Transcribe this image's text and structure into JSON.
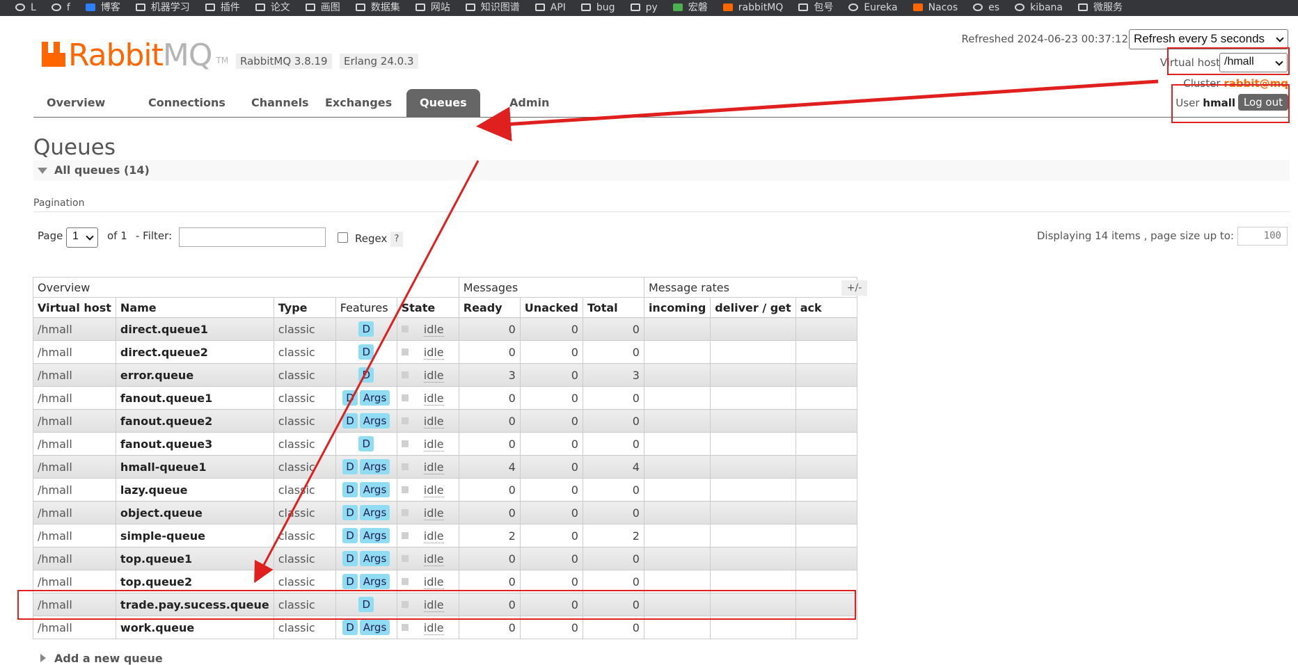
{
  "bookmarks": [
    {
      "label": "L",
      "icon": "github-icon"
    },
    {
      "label": "f",
      "icon": "github-icon"
    },
    {
      "label": "博客",
      "icon": "blog-icon"
    },
    {
      "label": "机器学习",
      "icon": "folder-icon"
    },
    {
      "label": "插件",
      "icon": "folder-icon"
    },
    {
      "label": "论文",
      "icon": "folder-icon"
    },
    {
      "label": "画图",
      "icon": "folder-icon"
    },
    {
      "label": "数据集",
      "icon": "folder-icon"
    },
    {
      "label": "网站",
      "icon": "folder-icon"
    },
    {
      "label": "知识图谱",
      "icon": "folder-icon"
    },
    {
      "label": "API",
      "icon": "folder-icon"
    },
    {
      "label": "bug",
      "icon": "folder-icon"
    },
    {
      "label": "py",
      "icon": "folder-icon"
    },
    {
      "label": "宏磐",
      "icon": "green-icon"
    },
    {
      "label": "rabbitMQ",
      "icon": "rabbitmq-icon"
    },
    {
      "label": "包号",
      "icon": "folder-icon"
    },
    {
      "label": "Eureka",
      "icon": "globe-icon"
    },
    {
      "label": "Nacos",
      "icon": "nacos-icon"
    },
    {
      "label": "es",
      "icon": "elastic-icon"
    },
    {
      "label": "kibana",
      "icon": "kibana-icon"
    },
    {
      "label": "微服务",
      "icon": "folder-icon"
    }
  ],
  "header": {
    "logo_rabbit": "Rabbit",
    "logo_mq": "MQ",
    "logo_tm": "TM",
    "version": "RabbitMQ 3.8.19",
    "erlang": "Erlang 24.0.3",
    "refreshed": "Refreshed 2024-06-23 00:37:12",
    "refresh_select": "Refresh every 5 seconds",
    "vhost_label": "Virtual host",
    "vhost_value": "/hmall",
    "cluster_label": "Cluster",
    "cluster_value": "rabbit@mq",
    "user_label": "User",
    "user_value": "hmall",
    "logout": "Log out"
  },
  "tabs": [
    "Overview",
    "Connections",
    "Channels",
    "Exchanges",
    "Queues",
    "Admin"
  ],
  "active_tab": "Queues",
  "page": {
    "title": "Queues",
    "section": "All queues (14)",
    "pagination_label": "Pagination",
    "page_label": "Page",
    "page_value": "1",
    "of_label": "of 1",
    "filter_label": "- Filter:",
    "filter_value": "",
    "regex_label": "Regex",
    "help": "?",
    "displaying": "Displaying 14 items , page size up to:",
    "page_size": "100",
    "add_queue": "Add a new queue"
  },
  "table": {
    "groups": [
      "Overview",
      "Messages",
      "Message rates"
    ],
    "plusminus": "+/-",
    "columns": [
      "Virtual host",
      "Name",
      "Type",
      "Features",
      "State",
      "Ready",
      "Unacked",
      "Total",
      "incoming",
      "deliver / get",
      "ack"
    ],
    "rows": [
      {
        "vhost": "/hmall",
        "name": "direct.queue1",
        "type": "classic",
        "features": [
          "D"
        ],
        "state": "idle",
        "ready": "0",
        "unacked": "0",
        "total": "0"
      },
      {
        "vhost": "/hmall",
        "name": "direct.queue2",
        "type": "classic",
        "features": [
          "D"
        ],
        "state": "idle",
        "ready": "0",
        "unacked": "0",
        "total": "0"
      },
      {
        "vhost": "/hmall",
        "name": "error.queue",
        "type": "classic",
        "features": [
          "D"
        ],
        "state": "idle",
        "ready": "3",
        "unacked": "0",
        "total": "3"
      },
      {
        "vhost": "/hmall",
        "name": "fanout.queue1",
        "type": "classic",
        "features": [
          "D",
          "Args"
        ],
        "state": "idle",
        "ready": "0",
        "unacked": "0",
        "total": "0"
      },
      {
        "vhost": "/hmall",
        "name": "fanout.queue2",
        "type": "classic",
        "features": [
          "D",
          "Args"
        ],
        "state": "idle",
        "ready": "0",
        "unacked": "0",
        "total": "0"
      },
      {
        "vhost": "/hmall",
        "name": "fanout.queue3",
        "type": "classic",
        "features": [
          "D"
        ],
        "state": "idle",
        "ready": "0",
        "unacked": "0",
        "total": "0"
      },
      {
        "vhost": "/hmall",
        "name": "hmall-queue1",
        "type": "classic",
        "features": [
          "D",
          "Args"
        ],
        "state": "idle",
        "ready": "4",
        "unacked": "0",
        "total": "4"
      },
      {
        "vhost": "/hmall",
        "name": "lazy.queue",
        "type": "classic",
        "features": [
          "D",
          "Args"
        ],
        "state": "idle",
        "ready": "0",
        "unacked": "0",
        "total": "0"
      },
      {
        "vhost": "/hmall",
        "name": "object.queue",
        "type": "classic",
        "features": [
          "D",
          "Args"
        ],
        "state": "idle",
        "ready": "0",
        "unacked": "0",
        "total": "0"
      },
      {
        "vhost": "/hmall",
        "name": "simple-queue",
        "type": "classic",
        "features": [
          "D",
          "Args"
        ],
        "state": "idle",
        "ready": "2",
        "unacked": "0",
        "total": "2"
      },
      {
        "vhost": "/hmall",
        "name": "top.queue1",
        "type": "classic",
        "features": [
          "D",
          "Args"
        ],
        "state": "idle",
        "ready": "0",
        "unacked": "0",
        "total": "0"
      },
      {
        "vhost": "/hmall",
        "name": "top.queue2",
        "type": "classic",
        "features": [
          "D",
          "Args"
        ],
        "state": "idle",
        "ready": "0",
        "unacked": "0",
        "total": "0"
      },
      {
        "vhost": "/hmall",
        "name": "trade.pay.sucess.queue",
        "type": "classic",
        "features": [
          "D"
        ],
        "state": "idle",
        "ready": "0",
        "unacked": "0",
        "total": "0"
      },
      {
        "vhost": "/hmall",
        "name": "work.queue",
        "type": "classic",
        "features": [
          "D",
          "Args"
        ],
        "state": "idle",
        "ready": "0",
        "unacked": "0",
        "total": "0"
      }
    ]
  },
  "colors": {
    "brand": "#ff6600",
    "tab_active": "#666666",
    "feature_badge": "#8fdcf3",
    "annotation": "#e0201e"
  }
}
